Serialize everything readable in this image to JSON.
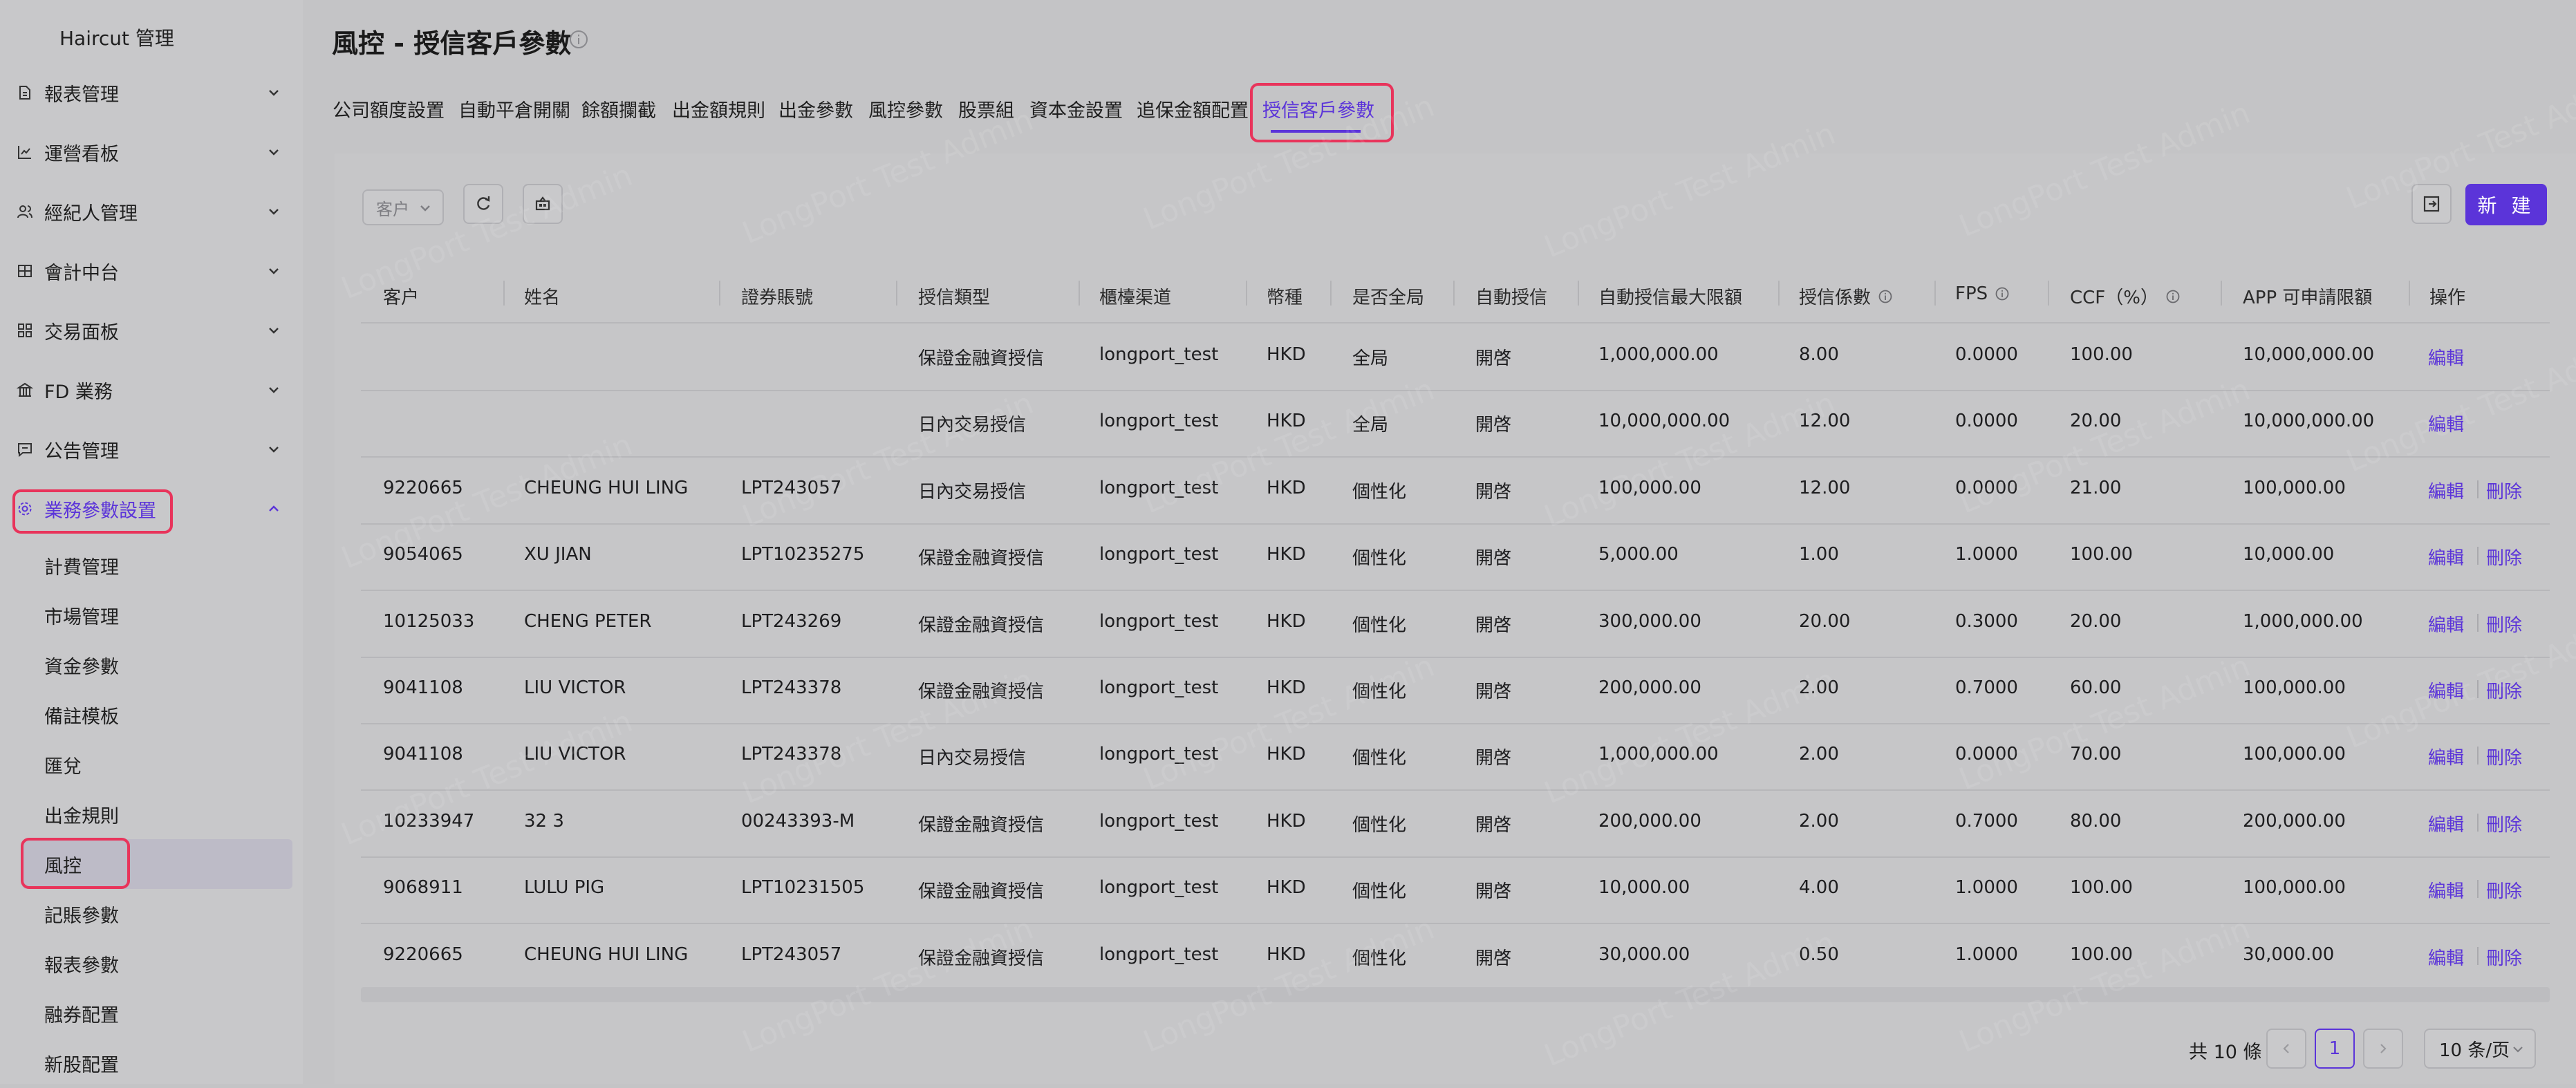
{
  "sidebar": {
    "header": "Haircut 管理",
    "menu": [
      {
        "label": "報表管理",
        "icon": "file-icon"
      },
      {
        "label": "運營看板",
        "icon": "chart-line-icon"
      },
      {
        "label": "經紀人管理",
        "icon": "users-icon"
      },
      {
        "label": "會計中台",
        "icon": "ledger-icon"
      },
      {
        "label": "交易面板",
        "icon": "grid-icon"
      },
      {
        "label": "FD 業務",
        "icon": "bank-icon"
      },
      {
        "label": "公告管理",
        "icon": "message-icon"
      },
      {
        "label": "業務參數設置",
        "icon": "settings-icon",
        "expanded": true
      }
    ],
    "submenu": [
      "計費管理",
      "市場管理",
      "資金參數",
      "備註模板",
      "匯兌",
      "出金規則",
      "風控",
      "記賬參數",
      "報表參數",
      "融券配置",
      "新股配置"
    ],
    "selected_submenu": "風控"
  },
  "page": {
    "title": "風控 - 授信客戶參數"
  },
  "tabs": [
    "公司額度設置",
    "自動平倉開關",
    "餘額攔截",
    "出金額規則",
    "出金參數",
    "風控參數",
    "股票組",
    "資本金設置",
    "追保金額配置",
    "授信客戶參數"
  ],
  "active_tab": "授信客戶參數",
  "toolbar": {
    "filter_placeholder": "客户",
    "new_button": "新 建"
  },
  "table": {
    "columns": [
      "客户",
      "姓名",
      "證券賬號",
      "授信類型",
      "櫃檯渠道",
      "幣種",
      "是否全局",
      "自動授信",
      "自動授信最大限額",
      "授信係數",
      "FPS",
      "CCF（%）",
      "APP 可申請限額",
      "操作"
    ],
    "rows": [
      {
        "client": "",
        "name": "",
        "account": "",
        "type": "保證金融資授信",
        "channel": "longport_test",
        "currency": "HKD",
        "global": "全局",
        "auto": "開啓",
        "max": "1,000,000.00",
        "coef": "8.00",
        "fps": "0.0000",
        "ccf": "100.00",
        "app_limit": "10,000,000.00",
        "ops": [
          "編輯"
        ]
      },
      {
        "client": "",
        "name": "",
        "account": "",
        "type": "日內交易授信",
        "channel": "longport_test",
        "currency": "HKD",
        "global": "全局",
        "auto": "開啓",
        "max": "10,000,000.00",
        "coef": "12.00",
        "fps": "0.0000",
        "ccf": "20.00",
        "app_limit": "10,000,000.00",
        "ops": [
          "編輯"
        ]
      },
      {
        "client": "9220665",
        "name": "CHEUNG HUI LING",
        "account": "LPT243057",
        "type": "日內交易授信",
        "channel": "longport_test",
        "currency": "HKD",
        "global": "個性化",
        "auto": "開啓",
        "max": "100,000.00",
        "coef": "12.00",
        "fps": "0.0000",
        "ccf": "21.00",
        "app_limit": "100,000.00",
        "ops": [
          "編輯",
          "刪除"
        ]
      },
      {
        "client": "9054065",
        "name": "XU JIAN",
        "account": "LPT10235275",
        "type": "保證金融資授信",
        "channel": "longport_test",
        "currency": "HKD",
        "global": "個性化",
        "auto": "開啓",
        "max": "5,000.00",
        "coef": "1.00",
        "fps": "1.0000",
        "ccf": "100.00",
        "app_limit": "10,000.00",
        "ops": [
          "編輯",
          "刪除"
        ]
      },
      {
        "client": "10125033",
        "name": "CHENG PETER",
        "account": "LPT243269",
        "type": "保證金融資授信",
        "channel": "longport_test",
        "currency": "HKD",
        "global": "個性化",
        "auto": "開啓",
        "max": "300,000.00",
        "coef": "20.00",
        "fps": "0.3000",
        "ccf": "20.00",
        "app_limit": "1,000,000.00",
        "ops": [
          "編輯",
          "刪除"
        ]
      },
      {
        "client": "9041108",
        "name": "LIU VICTOR",
        "account": "LPT243378",
        "type": "保證金融資授信",
        "channel": "longport_test",
        "currency": "HKD",
        "global": "個性化",
        "auto": "開啓",
        "max": "200,000.00",
        "coef": "2.00",
        "fps": "0.7000",
        "ccf": "60.00",
        "app_limit": "100,000.00",
        "ops": [
          "編輯",
          "刪除"
        ]
      },
      {
        "client": "9041108",
        "name": "LIU VICTOR",
        "account": "LPT243378",
        "type": "日內交易授信",
        "channel": "longport_test",
        "currency": "HKD",
        "global": "個性化",
        "auto": "開啓",
        "max": "1,000,000.00",
        "coef": "2.00",
        "fps": "0.0000",
        "ccf": "70.00",
        "app_limit": "100,000.00",
        "ops": [
          "編輯",
          "刪除"
        ]
      },
      {
        "client": "10233947",
        "name": "32 3",
        "account": "00243393-M",
        "type": "保證金融資授信",
        "channel": "longport_test",
        "currency": "HKD",
        "global": "個性化",
        "auto": "開啓",
        "max": "200,000.00",
        "coef": "2.00",
        "fps": "0.7000",
        "ccf": "80.00",
        "app_limit": "200,000.00",
        "ops": [
          "編輯",
          "刪除"
        ]
      },
      {
        "client": "9068911",
        "name": "LULU PIG",
        "account": "LPT10231505",
        "type": "保證金融資授信",
        "channel": "longport_test",
        "currency": "HKD",
        "global": "個性化",
        "auto": "開啓",
        "max": "10,000.00",
        "coef": "4.00",
        "fps": "1.0000",
        "ccf": "100.00",
        "app_limit": "100,000.00",
        "ops": [
          "編輯",
          "刪除"
        ]
      },
      {
        "client": "9220665",
        "name": "CHEUNG HUI LING",
        "account": "LPT243057",
        "type": "保證金融資授信",
        "channel": "longport_test",
        "currency": "HKD",
        "global": "個性化",
        "auto": "開啓",
        "max": "30,000.00",
        "coef": "0.50",
        "fps": "1.0000",
        "ccf": "100.00",
        "app_limit": "30,000.00",
        "ops": [
          "編輯",
          "刪除"
        ]
      }
    ]
  },
  "pagination": {
    "total": "共 10 條",
    "current_page": "1",
    "page_size": "10 条/页"
  },
  "watermark": "LongPort Test Admin",
  "colors": {
    "accent": "#5b34d9",
    "highlight": "#e8345b"
  }
}
